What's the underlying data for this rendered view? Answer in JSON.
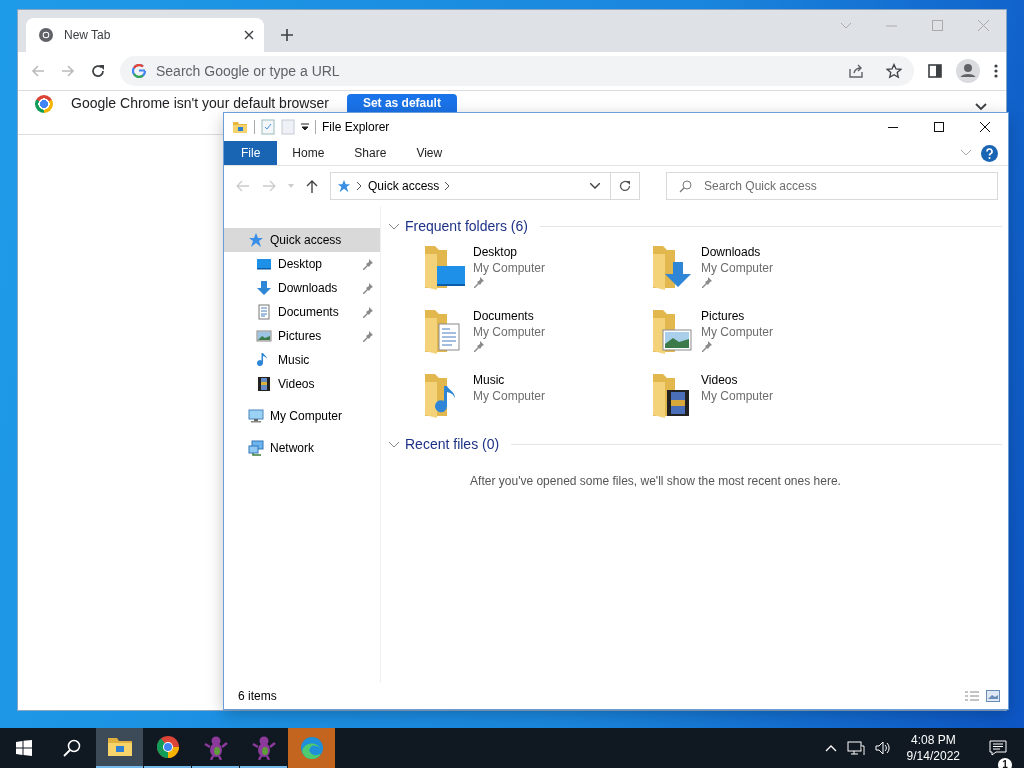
{
  "chrome": {
    "tabs": [
      {
        "title": "New Tab",
        "selected": true
      }
    ],
    "omnibox": {
      "placeholder": "Search Google or type a URL"
    },
    "infobar": {
      "message": "Google Chrome isn't your default browser",
      "button": "Set as default"
    }
  },
  "explorer": {
    "title": "File Explorer",
    "ribbon_tabs": [
      {
        "label": "File",
        "kind": "file"
      },
      {
        "label": "Home",
        "kind": "tab"
      },
      {
        "label": "Share",
        "kind": "tab"
      },
      {
        "label": "View",
        "kind": "tab"
      }
    ],
    "breadcrumb": [
      "Quick access"
    ],
    "search": {
      "placeholder": "Search Quick access"
    },
    "nav": [
      {
        "label": "Quick access",
        "kind": "star",
        "selected": true,
        "children": [
          {
            "label": "Desktop",
            "kind": "desktop",
            "selected": false,
            "pinned": true
          },
          {
            "label": "Downloads",
            "kind": "downloads",
            "selected": false,
            "pinned": true
          },
          {
            "label": "Documents",
            "kind": "documents",
            "selected": false,
            "pinned": true
          },
          {
            "label": "Pictures",
            "kind": "pictures",
            "selected": false,
            "pinned": true
          },
          {
            "label": "Music",
            "kind": "music",
            "selected": false,
            "pinned": false
          },
          {
            "label": "Videos",
            "kind": "videos",
            "selected": false,
            "pinned": false
          }
        ]
      },
      {
        "label": "My Computer",
        "kind": "computer",
        "selected": false
      },
      {
        "label": "Network",
        "kind": "network",
        "selected": false
      }
    ],
    "groups": [
      {
        "title": "Frequent folders (6)",
        "expanded": true,
        "folders": [
          {
            "name": "Desktop",
            "location": "My Computer",
            "kind": "desktop",
            "pinned": true
          },
          {
            "name": "Downloads",
            "location": "My Computer",
            "kind": "downloads",
            "pinned": true
          },
          {
            "name": "Documents",
            "location": "My Computer",
            "kind": "documents",
            "pinned": true
          },
          {
            "name": "Pictures",
            "location": "My Computer",
            "kind": "pictures",
            "pinned": true
          },
          {
            "name": "Music",
            "location": "My Computer",
            "kind": "music",
            "pinned": false
          },
          {
            "name": "Videos",
            "location": "My Computer",
            "kind": "videos",
            "pinned": false
          }
        ]
      },
      {
        "title": "Recent files (0)",
        "expanded": true,
        "empty_message": "After you've opened some files, we'll show the most recent ones here."
      }
    ],
    "status": "6 items"
  },
  "taskbar": {
    "apps": [
      {
        "kind": "explorer",
        "running": true,
        "selected": true,
        "attention": false
      },
      {
        "kind": "chrome",
        "running": true,
        "selected": false,
        "attention": false
      },
      {
        "kind": "dino",
        "running": true,
        "selected": false,
        "attention": false
      },
      {
        "kind": "dino",
        "running": true,
        "selected": false,
        "attention": false
      },
      {
        "kind": "edge",
        "running": false,
        "selected": false,
        "attention": true
      }
    ],
    "clock": {
      "time": "4:08 PM",
      "date": "9/14/2022"
    },
    "notifications": "1"
  }
}
